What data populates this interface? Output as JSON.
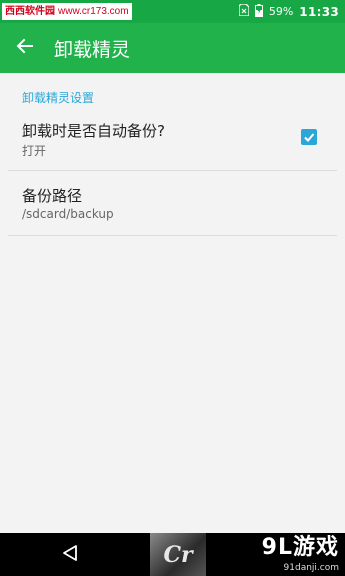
{
  "status_bar": {
    "watermark_site_name": "西西软件园",
    "watermark_url": "www.cr173.com",
    "battery_percent": "59%",
    "time": "11:33"
  },
  "app_bar": {
    "back_icon": "arrow-left-icon",
    "title": "卸载精灵"
  },
  "settings": {
    "section_header": "卸载精灵设置",
    "items": [
      {
        "title": "卸载时是否自动备份?",
        "summary": "打开",
        "checked": true
      },
      {
        "title": "备份路径",
        "summary": "/sdcard/backup"
      }
    ]
  },
  "nav_bar": {
    "back_icon": "triangle-back-icon",
    "watermark_logo_text": "Cr",
    "watermark_brand": "9L游戏",
    "watermark_url": "91danji.com"
  },
  "colors": {
    "app_bar": "#21b24c",
    "status_bar": "#17a845",
    "accent": "#2aa7d8",
    "background": "#f3f3f3"
  }
}
